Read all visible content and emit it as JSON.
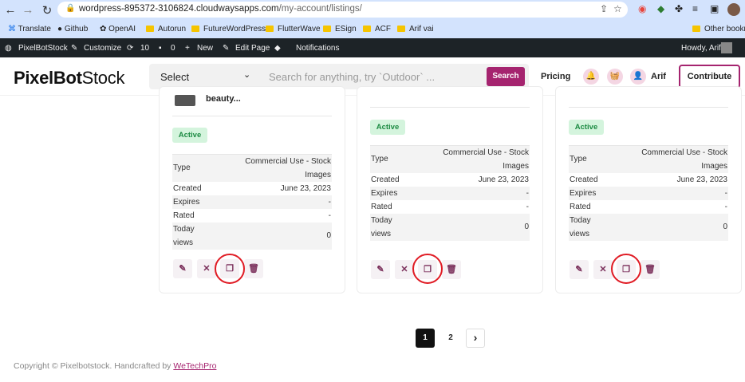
{
  "browser": {
    "url_domain": "wordpress-895372-3106824.cloudwaysapps.com",
    "url_path": "/my-account/listings/",
    "bookmarks": [
      {
        "label": "Translate",
        "icon": "translate-icon"
      },
      {
        "label": "Github",
        "icon": "github-icon"
      },
      {
        "label": "OpenAI",
        "icon": "openai-icon"
      },
      {
        "label": "Autorun",
        "icon": "folder-icon"
      },
      {
        "label": "FutureWordPress",
        "icon": "folder-icon"
      },
      {
        "label": "FlutterWave",
        "icon": "folder-icon"
      },
      {
        "label": "ESign",
        "icon": "folder-icon"
      },
      {
        "label": "ACF",
        "icon": "folder-icon"
      },
      {
        "label": "Arif vai",
        "icon": "folder-icon"
      }
    ],
    "other_bookmarks": "Other bookm"
  },
  "wp_admin": {
    "site_name": "PixelBotStock",
    "customize": "Customize",
    "updates": "10",
    "comments": "0",
    "new": "New",
    "edit_page": "Edit Page",
    "notifications": "Notifications",
    "howdy": "Howdy, Arif"
  },
  "header": {
    "logo_bold": "PixelBot",
    "logo_light": "Stock",
    "select": "Select",
    "search_placeholder": "Search for anything, try `Outdoor` ...",
    "search_button": "Search",
    "pricing": "Pricing",
    "user": "Arif",
    "contribute": "Contribute"
  },
  "cards": [
    {
      "title": "beauty...",
      "status": "Active",
      "type_label": "Type",
      "type_value": "Commercial Use - Stock Images",
      "created_label": "Created",
      "created_value": "June 23, 2023",
      "expires_label": "Expires",
      "expires_value": "-",
      "rated_label": "Rated",
      "rated_value": "-",
      "views_label": "Today views",
      "views_value": "0"
    },
    {
      "title": "",
      "status": "Active",
      "type_label": "Type",
      "type_value": "Commercial Use - Stock Images",
      "created_label": "Created",
      "created_value": "June 23, 2023",
      "expires_label": "Expires",
      "expires_value": "-",
      "rated_label": "Rated",
      "rated_value": "-",
      "views_label": "Today views",
      "views_value": "0"
    },
    {
      "title": "",
      "status": "Active",
      "type_label": "Type",
      "type_value": "Commercial Use - Stock Images",
      "created_label": "Created",
      "created_value": "June 23, 2023",
      "expires_label": "Expires",
      "expires_value": "-",
      "rated_label": "Rated",
      "rated_value": "-",
      "views_label": "Today views",
      "views_value": "0"
    }
  ],
  "actions": [
    "edit-icon",
    "close-icon",
    "duplicate-icon",
    "trash-icon"
  ],
  "pagination": {
    "pages": [
      "1",
      "2"
    ],
    "current": "1",
    "next": "›"
  },
  "footer": {
    "text": "Copyright © Pixelbotstock. Handcrafted by ",
    "link": "WeTechPro"
  },
  "colors": {
    "brand": "#a5246f",
    "active_bg": "#d4f4dd",
    "active_text": "#1d8b43",
    "highlight": "#e01b24"
  }
}
